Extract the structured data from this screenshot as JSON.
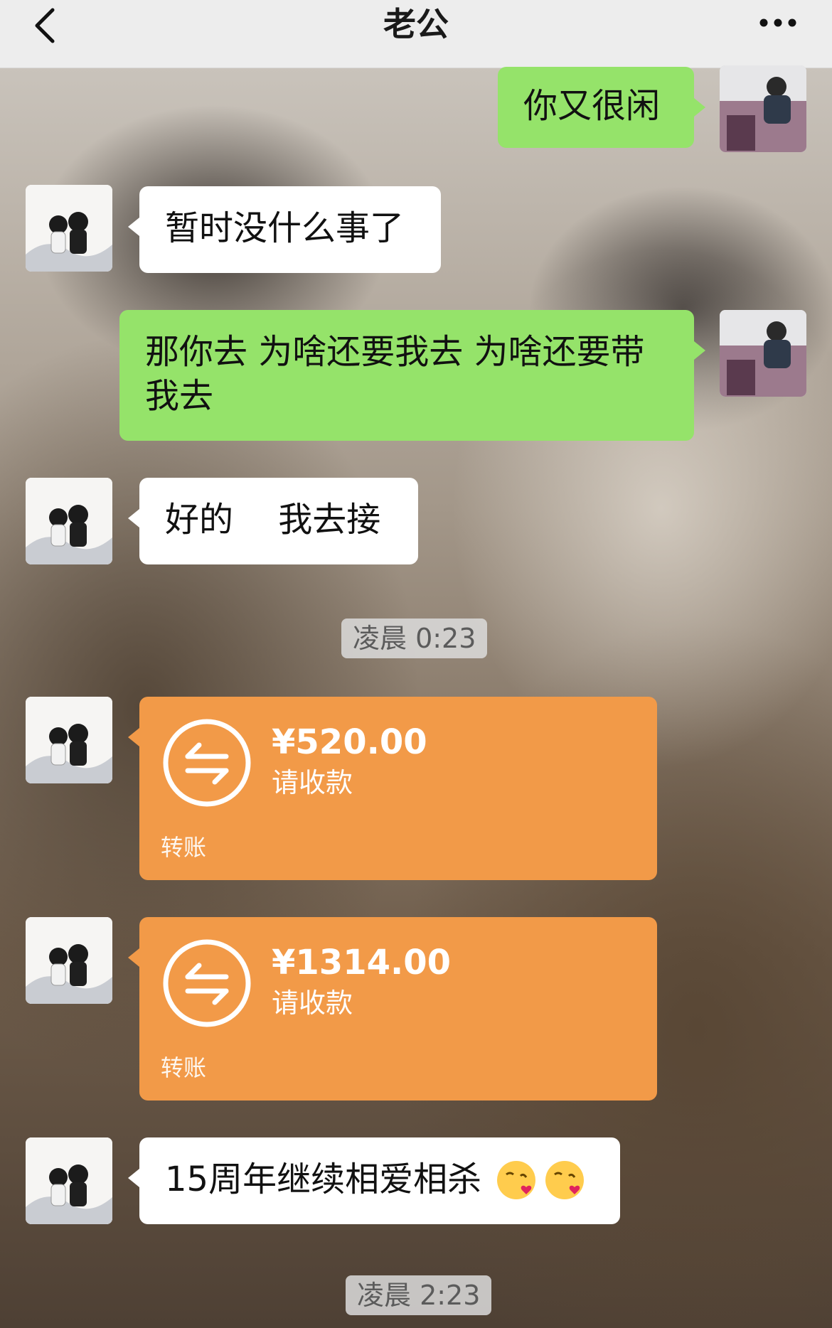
{
  "header": {
    "title": "老公"
  },
  "messages": {
    "m1": "你又很闲",
    "m2": "暂时没什么事了",
    "m3": "那你去 为啥还要我去 为啥还要带我去",
    "m4": "好的 　我去接",
    "m5": "15周年继续相爱相杀"
  },
  "times": {
    "t1": "凌晨 0:23",
    "t2": "凌晨 2:23"
  },
  "transfers": [
    {
      "amount": "¥520.00",
      "sub": "请收款",
      "label": "转账"
    },
    {
      "amount": "¥1314.00",
      "sub": "请收款",
      "label": "转账"
    }
  ],
  "emoji": "kissing-heart-emoji",
  "colors": {
    "header_bg": "#ededed",
    "green_bubble": "#95e36a",
    "white_bubble": "#ffffff",
    "transfer_orange": "#f29a48"
  }
}
